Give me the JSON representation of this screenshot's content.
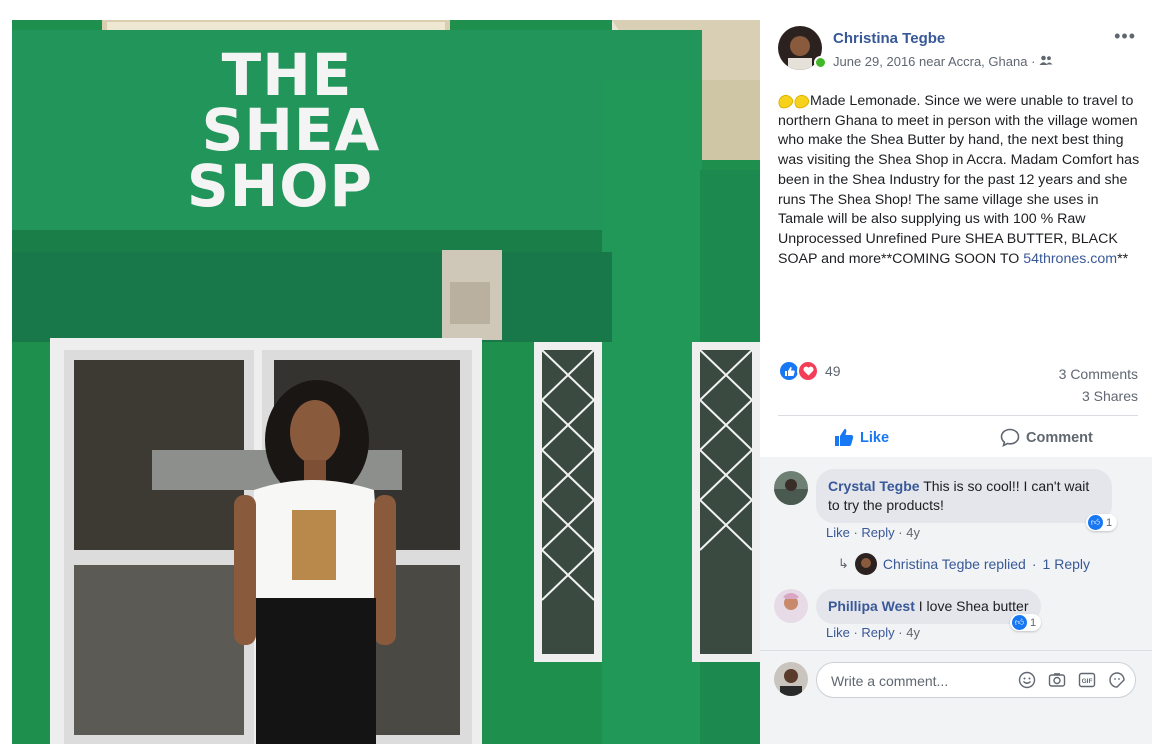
{
  "photo": {
    "sign_lines": [
      "THE",
      "SHEA",
      "SHOP"
    ]
  },
  "post": {
    "author": "Christina Tegbe",
    "date": "June 29, 2016",
    "location": "near Accra, Ghana",
    "separator": "·",
    "audience_icon": "friends-icon",
    "body_prefix_emoji": [
      "lemon",
      "lemon"
    ],
    "body_text": "Made Lemonade. Since we were unable to travel to northern Ghana to meet in person with the village women who make the Shea Butter by hand, the next best thing was visiting the Shea Shop in Accra. Madam Comfort has been in the Shea Industry for the past 12 years and she runs The Shea Shop! The same village she uses in Tamale will be also supplying us with 100 % Raw Unprocessed Unrefined Pure SHEA BUTTER, BLACK SOAP and more**COMING SOON TO ",
    "link_text": "54thrones.com",
    "body_suffix": "**",
    "more_label": "•••"
  },
  "reactions": {
    "count": "49",
    "comments": "3 Comments",
    "shares": "3 Shares"
  },
  "actions": {
    "like": "Like",
    "comment": "Comment"
  },
  "comments": [
    {
      "name": "Crystal Tegbe",
      "text": "This is so cool!! I can't wait to try the products!",
      "like": "Like",
      "reply": "Reply",
      "age": "4y",
      "reaction_count": "1"
    },
    {
      "name": "Phillipa West",
      "text": "I love Shea butter",
      "like": "Like",
      "reply": "Reply",
      "age": "4y",
      "reaction_count": "1"
    }
  ],
  "reply_summary": {
    "text": "Christina Tegbe replied",
    "count": "1 Reply"
  },
  "composer": {
    "placeholder": "Write a comment...",
    "icons": [
      "emoji-icon",
      "camera-icon",
      "gif-icon",
      "sticker-icon"
    ]
  },
  "colors": {
    "accent_blue": "#385898",
    "like_blue": "#1877f2",
    "love_red": "#f33e58",
    "shop_green": "#1f8f4e"
  }
}
